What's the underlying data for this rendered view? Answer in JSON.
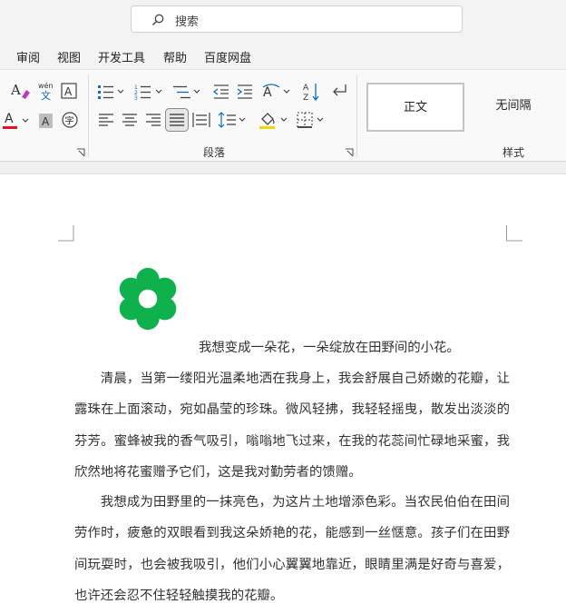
{
  "search": {
    "placeholder": "搜索"
  },
  "menu": [
    "审阅",
    "视图",
    "开发工具",
    "帮助",
    "百度网盘"
  ],
  "ribbon": {
    "paragraph_group_label": "段落",
    "styles_group_label": "样式",
    "styles": [
      "正文",
      "无间隔"
    ],
    "colors": {
      "font_color_underline": "#e81123",
      "accent": "#0f6cbd"
    }
  },
  "document": {
    "caption": "我想变成一朵花，一朵绽放在田野间的小花。",
    "paragraphs": [
      "清晨，当第一缕阳光温柔地洒在我身上，我会舒展自己娇嫩的花瓣，让露珠在上面滚动，宛如晶莹的珍珠。微风轻拂，我轻轻摇曳，散发出淡淡的芬芳。蜜蜂被我的香气吸引，嗡嗡地飞过来，在我的花蕊间忙碌地采蜜，我欣然地将花蜜赠予它们，这是我对勤劳者的馈赠。",
      "我想成为田野里的一抹亮色，为这片土地增添色彩。当农民伯伯在田间劳作时，疲惫的双眼看到我这朵娇艳的花，能感到一丝惬意。孩子们在田野间玩耍时，也会被我吸引，他们小心翼翼地靠近，眼睛里满是好奇与喜爱，也许还会忍不住轻轻触摸我的花瓣。"
    ],
    "flower_color": "#0fb14c"
  }
}
